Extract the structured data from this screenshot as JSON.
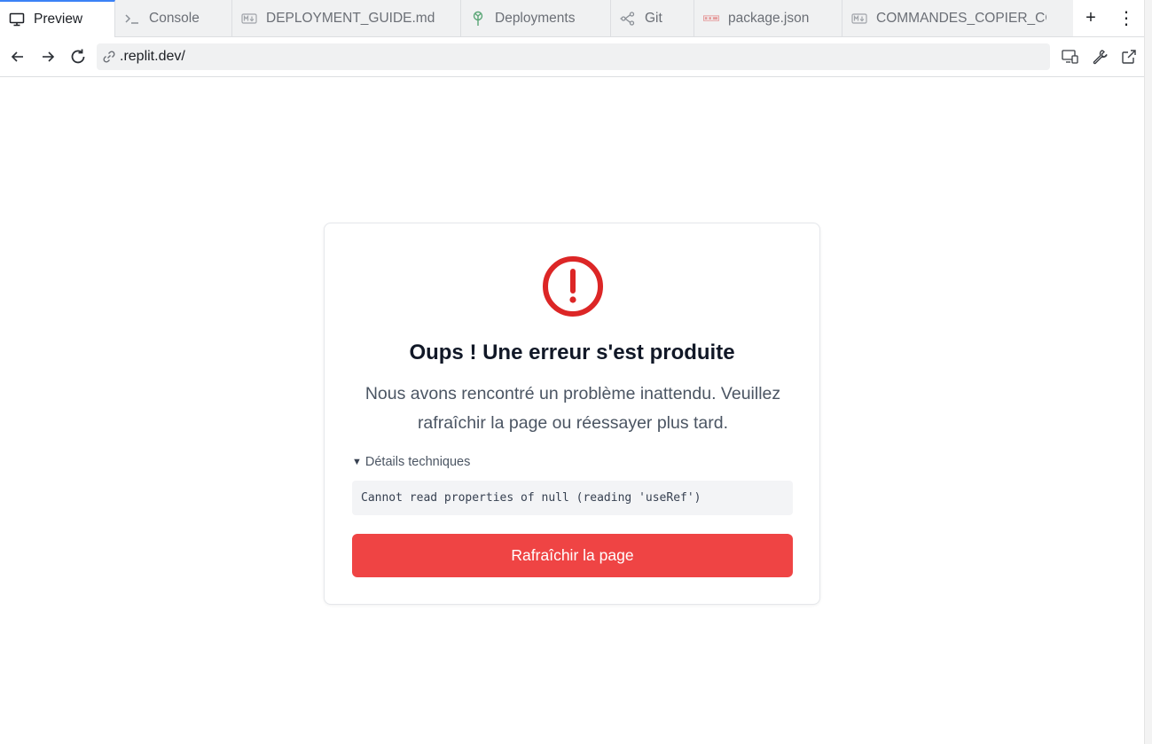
{
  "tabs": [
    {
      "label": "Preview",
      "icon": "monitor-icon",
      "active": true
    },
    {
      "label": "Console",
      "icon": "terminal-icon"
    },
    {
      "label": "DEPLOYMENT_GUIDE.md",
      "icon": "markdown-file-icon"
    },
    {
      "label": "Deployments",
      "icon": "deployments-icon"
    },
    {
      "label": "Git",
      "icon": "git-branch-icon"
    },
    {
      "label": "package.json",
      "icon": "npm-icon"
    },
    {
      "label": "COMMANDES_COPIER_COLL",
      "icon": "markdown-file-icon"
    }
  ],
  "tab_actions": {
    "new_tab": "+",
    "more": "⋮"
  },
  "address": {
    "url": ".replit.dev/"
  },
  "error": {
    "title": "Oups ! Une erreur s'est produite",
    "message": "Nous avons rencontré un problème inattendu. Veuillez rafraîchir la page ou réessayer plus tard.",
    "details_label": "Détails techniques",
    "details_marker": "▼",
    "details_text": "Cannot read properties of null (reading 'useRef')",
    "button_label": "Rafraîchir la page"
  },
  "colors": {
    "accent_blue": "#3b82f6",
    "error_red": "#dc2626",
    "button_red": "#ef4444"
  }
}
